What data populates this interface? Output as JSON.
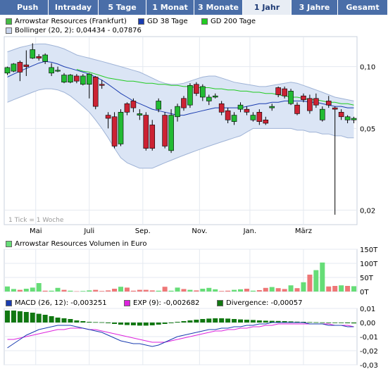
{
  "tabs": [
    {
      "label": "Push",
      "active": false
    },
    {
      "label": "Intraday",
      "active": false
    },
    {
      "label": "5 Tage",
      "active": false
    },
    {
      "label": "1 Monat",
      "active": false
    },
    {
      "label": "3 Monate",
      "active": false
    },
    {
      "label": "1 Jahr",
      "active": true
    },
    {
      "label": "3 Jahre",
      "active": false
    },
    {
      "label": "Gesamt",
      "active": false
    }
  ],
  "colors": {
    "tab_bg": "#4a6ea8",
    "tab_active_bg": "#e8edf4",
    "up": "#22bb33",
    "down": "#cc2233",
    "gd38": "#1a3cb0",
    "gd200": "#22cc22",
    "bollinger_fill": "#dbe5f5",
    "macd": "#1a3cb0",
    "exp": "#dd22dd",
    "divergence": "#117711",
    "vol_up": "#66dd77",
    "vol_down": "#ee7777"
  },
  "legend": {
    "price": "Arrowstar Resources (Frankfurt)",
    "gd38": "GD 38 Tage",
    "gd200": "GD 200 Tage",
    "bollinger": "Bollinger (20, 2): 0,04434 - 0,07876",
    "volume": "Arrowstar Resources Volumen in Euro",
    "macd": "MACD (26, 12): -0,003251",
    "exp": "EXP (9): -0,002682",
    "divergence": "Divergence: -0,00057"
  },
  "tick_note": "1 Tick = 1 Woche",
  "chart_data": [
    {
      "type": "candlestick",
      "title": "Arrowstar Resources (Frankfurt)",
      "scale": "log",
      "ylim": [
        0.017,
        0.14
      ],
      "yticks": [
        {
          "v": 0.1,
          "label": "0,10"
        },
        {
          "v": 0.05,
          "label": "0,05"
        },
        {
          "v": 0.02,
          "label": "0,02"
        }
      ],
      "xticks": [
        {
          "i": 4.5,
          "label": "Mai"
        },
        {
          "i": 13,
          "label": "Juli"
        },
        {
          "i": 21.5,
          "label": "Sep."
        },
        {
          "i": 30.5,
          "label": "Nov."
        },
        {
          "i": 38.5,
          "label": "Jan."
        },
        {
          "i": 47,
          "label": "März"
        }
      ],
      "candles": [
        [
          0.093,
          0.099,
          0.1,
          0.091
        ],
        [
          0.095,
          0.103,
          0.104,
          0.094
        ],
        [
          0.105,
          0.094,
          0.107,
          0.085
        ],
        [
          0.102,
          0.1,
          0.12,
          0.09
        ],
        [
          0.11,
          0.121,
          0.13,
          0.109
        ],
        [
          0.112,
          0.11,
          0.115,
          0.107
        ],
        [
          0.106,
          0.114,
          0.116,
          0.103
        ],
        [
          0.093,
          0.099,
          0.104,
          0.09
        ],
        [
          0.095,
          0.096,
          0.1,
          0.094
        ],
        [
          0.084,
          0.091,
          0.093,
          0.083
        ],
        [
          0.084,
          0.091,
          0.092,
          0.083
        ],
        [
          0.09,
          0.085,
          0.092,
          0.083
        ],
        [
          0.082,
          0.09,
          0.092,
          0.081
        ],
        [
          0.082,
          0.092,
          0.093,
          0.07
        ],
        [
          0.089,
          0.064,
          0.09,
          0.062
        ],
        [
          0.082,
          0.081,
          0.086,
          0.078
        ],
        [
          0.058,
          0.056,
          0.06,
          0.05
        ],
        [
          0.057,
          0.041,
          0.06,
          0.04
        ],
        [
          0.042,
          0.06,
          0.062,
          0.041
        ],
        [
          0.066,
          0.06,
          0.067,
          0.058
        ],
        [
          0.068,
          0.063,
          0.07,
          0.06
        ],
        [
          0.058,
          0.059,
          0.062,
          0.055
        ],
        [
          0.058,
          0.04,
          0.06,
          0.039
        ],
        [
          0.052,
          0.04,
          0.055,
          0.039
        ],
        [
          0.062,
          0.068,
          0.07,
          0.06
        ],
        [
          0.058,
          0.041,
          0.06,
          0.04
        ],
        [
          0.039,
          0.058,
          0.062,
          0.038
        ],
        [
          0.057,
          0.064,
          0.066,
          0.054
        ],
        [
          0.07,
          0.063,
          0.072,
          0.061
        ],
        [
          0.065,
          0.081,
          0.083,
          0.063
        ],
        [
          0.082,
          0.074,
          0.084,
          0.072
        ],
        [
          0.071,
          0.08,
          0.082,
          0.068
        ],
        [
          0.068,
          0.071,
          0.073,
          0.065
        ],
        [
          0.071,
          0.072,
          0.074,
          0.07
        ],
        [
          0.066,
          0.06,
          0.068,
          0.058
        ],
        [
          0.061,
          0.055,
          0.063,
          0.053
        ],
        [
          0.054,
          0.058,
          0.06,
          0.052
        ],
        [
          0.062,
          0.065,
          0.067,
          0.06
        ],
        [
          0.062,
          0.06,
          0.064,
          0.058
        ],
        [
          0.055,
          0.058,
          0.06,
          0.054
        ],
        [
          0.06,
          0.054,
          0.062,
          0.052
        ],
        [
          0.055,
          0.053,
          0.057,
          0.052
        ],
        [
          0.063,
          0.064,
          0.066,
          0.061
        ],
        [
          0.079,
          0.073,
          0.08,
          0.071
        ],
        [
          0.078,
          0.072,
          0.08,
          0.07
        ],
        [
          0.066,
          0.076,
          0.078,
          0.065
        ],
        [
          0.065,
          0.059,
          0.067,
          0.058
        ],
        [
          0.072,
          0.069,
          0.074,
          0.067
        ],
        [
          0.07,
          0.061,
          0.073,
          0.059
        ],
        [
          0.07,
          0.065,
          0.074,
          0.063
        ],
        [
          0.055,
          0.062,
          0.064,
          0.054
        ],
        [
          0.068,
          0.065,
          0.072,
          0.063
        ],
        [
          0.063,
          0.062,
          0.064,
          0.019
        ],
        [
          0.06,
          0.057,
          0.062,
          0.055
        ],
        [
          0.055,
          0.057,
          0.058,
          0.053
        ],
        [
          0.055,
          0.056,
          0.057,
          0.053
        ]
      ],
      "gd38": [
        0.089,
        0.092,
        0.095,
        0.098,
        0.101,
        0.104,
        0.106,
        0.105,
        0.103,
        0.1,
        0.098,
        0.096,
        0.094,
        0.092,
        0.089,
        0.086,
        0.082,
        0.078,
        0.074,
        0.071,
        0.068,
        0.066,
        0.064,
        0.062,
        0.061,
        0.06,
        0.059,
        0.058,
        0.058,
        0.059,
        0.06,
        0.061,
        0.062,
        0.063,
        0.063,
        0.063,
        0.063,
        0.063,
        0.064,
        0.065,
        0.066,
        0.066,
        0.067,
        0.067,
        0.068,
        0.068,
        0.068,
        0.068,
        0.067,
        0.067,
        0.066,
        0.065,
        0.064,
        0.064,
        0.063,
        0.063
      ],
      "gd200": [
        null,
        null,
        null,
        null,
        null,
        null,
        null,
        null,
        null,
        null,
        null,
        0.097,
        0.095,
        0.094,
        0.092,
        0.09,
        0.088,
        0.087,
        0.086,
        0.085,
        0.085,
        0.084,
        0.083,
        0.083,
        0.082,
        0.082,
        0.081,
        0.081,
        0.08,
        0.08,
        0.079,
        0.079,
        0.079,
        0.078,
        0.078,
        0.077,
        0.077,
        0.076,
        0.076,
        0.075,
        0.075,
        0.074,
        0.074,
        0.073,
        0.072,
        0.071,
        0.071,
        0.07,
        0.069,
        0.069,
        0.068,
        0.067,
        0.067,
        0.066,
        0.066,
        0.065
      ],
      "bollinger_upper": [
        0.118,
        0.121,
        0.124,
        0.126,
        0.128,
        0.129,
        0.129,
        0.127,
        0.125,
        0.122,
        0.118,
        0.114,
        0.112,
        0.11,
        0.108,
        0.106,
        0.104,
        0.102,
        0.1,
        0.098,
        0.096,
        0.094,
        0.091,
        0.088,
        0.085,
        0.083,
        0.082,
        0.082,
        0.083,
        0.085,
        0.087,
        0.089,
        0.09,
        0.09,
        0.088,
        0.086,
        0.084,
        0.083,
        0.082,
        0.081,
        0.08,
        0.08,
        0.081,
        0.082,
        0.083,
        0.084,
        0.083,
        0.081,
        0.079,
        0.077,
        0.075,
        0.073,
        0.071,
        0.07,
        0.069,
        0.068
      ],
      "bollinger_lower": [
        0.067,
        0.069,
        0.071,
        0.073,
        0.075,
        0.077,
        0.078,
        0.078,
        0.077,
        0.075,
        0.072,
        0.068,
        0.064,
        0.06,
        0.055,
        0.05,
        0.045,
        0.04,
        0.036,
        0.034,
        0.033,
        0.032,
        0.032,
        0.032,
        0.033,
        0.034,
        0.035,
        0.036,
        0.037,
        0.038,
        0.039,
        0.04,
        0.041,
        0.042,
        0.043,
        0.044,
        0.045,
        0.046,
        0.048,
        0.05,
        0.05,
        0.05,
        0.05,
        0.05,
        0.05,
        0.05,
        0.049,
        0.049,
        0.048,
        0.048,
        0.047,
        0.047,
        0.046,
        0.046,
        0.045,
        0.045
      ]
    },
    {
      "type": "bar",
      "title": "Arrowstar Resources Volumen in Euro",
      "ylim": [
        0,
        150000
      ],
      "yticks": [
        {
          "v": 150000,
          "label": "150T"
        },
        {
          "v": 100000,
          "label": "100T"
        },
        {
          "v": 50000,
          "label": "50T"
        },
        {
          "v": 0,
          "label": "0T"
        }
      ],
      "values": [
        18000,
        9000,
        6000,
        10000,
        14000,
        30000,
        3000,
        3000,
        13000,
        6000,
        3000,
        1000,
        2000,
        4000,
        6000,
        2000,
        4000,
        10000,
        17000,
        14000,
        3000,
        6000,
        6000,
        4000,
        3000,
        17000,
        3000,
        14000,
        9000,
        6000,
        4000,
        10000,
        13000,
        8000,
        2000,
        3000,
        6000,
        8000,
        10000,
        3000,
        5000,
        13000,
        16000,
        12000,
        9000,
        22000,
        12000,
        33000,
        60000,
        76000,
        103000,
        18000,
        20000,
        22000,
        20000,
        19000
      ],
      "up": [
        true,
        true,
        false,
        true,
        true,
        true,
        false,
        true,
        true,
        false,
        true,
        false,
        true,
        true,
        false,
        false,
        false,
        false,
        true,
        false,
        false,
        false,
        false,
        false,
        true,
        false,
        true,
        true,
        false,
        true,
        false,
        true,
        true,
        true,
        false,
        false,
        true,
        true,
        false,
        true,
        false,
        false,
        true,
        false,
        false,
        true,
        false,
        true,
        false,
        true,
        true,
        false,
        false,
        true,
        false,
        true
      ]
    },
    {
      "type": "line",
      "title": "MACD (26, 12)",
      "ylim": [
        -0.03,
        0.01
      ],
      "yticks": [
        {
          "v": 0.01,
          "label": "0,01"
        },
        {
          "v": 0.0,
          "label": "0,00"
        },
        {
          "v": -0.01,
          "label": "-0,01"
        },
        {
          "v": -0.02,
          "label": "-0,02"
        },
        {
          "v": -0.03,
          "label": "-0,03"
        }
      ],
      "series": [
        {
          "name": "MACD (26, 12)",
          "values": [
            -0.018,
            -0.015,
            -0.012,
            -0.009,
            -0.007,
            -0.005,
            -0.004,
            -0.003,
            -0.002,
            -0.002,
            -0.002,
            -0.003,
            -0.004,
            -0.005,
            -0.006,
            -0.007,
            -0.009,
            -0.011,
            -0.013,
            -0.014,
            -0.015,
            -0.015,
            -0.016,
            -0.017,
            -0.016,
            -0.014,
            -0.012,
            -0.01,
            -0.009,
            -0.008,
            -0.007,
            -0.006,
            -0.005,
            -0.005,
            -0.004,
            -0.004,
            -0.003,
            -0.003,
            -0.002,
            -0.002,
            -0.001,
            -0.001,
            0.0,
            0.0,
            0.0,
            0.0,
            0.0,
            0.0,
            -0.001,
            -0.001,
            -0.001,
            -0.002,
            -0.002,
            -0.002,
            -0.003,
            -0.003
          ]
        },
        {
          "name": "EXP (9)",
          "values": [
            -0.012,
            -0.012,
            -0.011,
            -0.01,
            -0.009,
            -0.008,
            -0.007,
            -0.006,
            -0.005,
            -0.005,
            -0.004,
            -0.004,
            -0.004,
            -0.005,
            -0.005,
            -0.006,
            -0.007,
            -0.008,
            -0.009,
            -0.01,
            -0.011,
            -0.012,
            -0.013,
            -0.014,
            -0.014,
            -0.014,
            -0.013,
            -0.012,
            -0.011,
            -0.01,
            -0.009,
            -0.008,
            -0.007,
            -0.006,
            -0.006,
            -0.005,
            -0.005,
            -0.004,
            -0.004,
            -0.003,
            -0.003,
            -0.002,
            -0.002,
            -0.001,
            -0.001,
            -0.001,
            -0.001,
            -0.001,
            -0.001,
            -0.001,
            -0.001,
            -0.001,
            -0.002,
            -0.002,
            -0.002,
            -0.003
          ]
        },
        {
          "name": "Divergence",
          "values": [
            0.0085,
            0.0085,
            0.008,
            0.0075,
            0.007,
            0.0062,
            0.0055,
            0.0045,
            0.0035,
            0.003,
            0.0025,
            0.0015,
            0.001,
            0.0005,
            0.0003,
            0.0002,
            -0.0005,
            -0.001,
            -0.0015,
            -0.0018,
            -0.002,
            -0.0022,
            -0.0022,
            -0.002,
            -0.0015,
            -0.001,
            -0.0005,
            0.0005,
            0.001,
            0.0015,
            0.002,
            0.0025,
            0.0028,
            0.003,
            0.003,
            0.0028,
            0.0025,
            0.0022,
            0.002,
            0.0018,
            0.0015,
            0.0013,
            0.0012,
            0.0011,
            0.001,
            0.0008,
            0.0006,
            0.0005,
            0.0003,
            0.0002,
            0.0001,
            0.0,
            -0.0002,
            -0.0003,
            -0.0005,
            -0.0006
          ]
        }
      ]
    }
  ]
}
